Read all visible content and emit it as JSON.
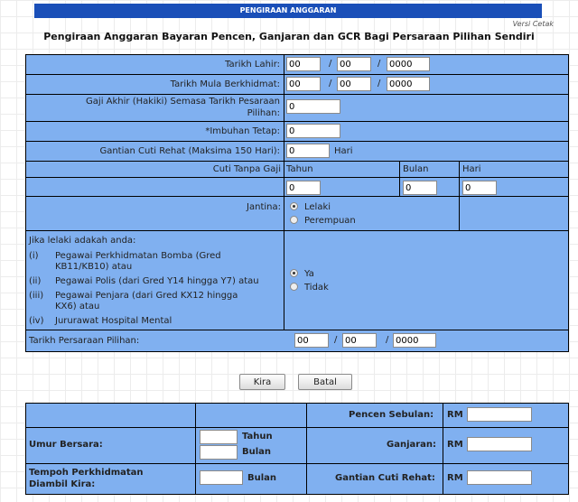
{
  "header": {
    "bar_title": "PENGIRAAN ANGGARAN",
    "print_link": "Versi Cetak",
    "page_title": "Pengiraan Anggaran Bayaran Pencen, Ganjaran dan GCR Bagi Persaraan Pilihan Sendiri"
  },
  "form": {
    "dob": {
      "label": "Tarikh Lahir:",
      "day": "00",
      "month": "00",
      "year": "0000"
    },
    "start_date": {
      "label": "Tarikh Mula Berkhidmat:",
      "day": "00",
      "month": "00",
      "year": "0000"
    },
    "last_salary": {
      "label_line1": "Gaji Akhir (Hakiki) Semasa Tarikh Pesaraan",
      "label_line2": "Pilihan:",
      "value": "0"
    },
    "allowance": {
      "label": "*Imbuhan Tetap:",
      "value": "0"
    },
    "leave_replacement": {
      "label": "Gantian Cuti Rehat (Maksima 150 Hari):",
      "value": "0",
      "unit": "Hari"
    },
    "unpaid_leave": {
      "label": "Cuti Tanpa Gaji",
      "col_years": "Tahun",
      "col_months": "Bulan",
      "col_days": "Hari",
      "years": "0",
      "months": "0",
      "days": "0"
    },
    "gender": {
      "label": "Jantina:",
      "options": [
        "Lelaki",
        "Perempuan"
      ],
      "selected": "Lelaki"
    },
    "special_service": {
      "question": "Jika lelaki adakah anda:",
      "items": [
        {
          "num": "(i)",
          "line1": "Pegawai Perkhidmatan Bomba (Gred",
          "line2": "KB11/KB10) atau"
        },
        {
          "num": "(ii)",
          "line1": "Pegawai Polis (dari Gred Y14 hingga Y7) atau",
          "line2": ""
        },
        {
          "num": "(iii)",
          "line1": "Pegawai Penjara (dari Gred KX12 hingga",
          "line2": "KX6) atau"
        },
        {
          "num": "(iv)",
          "line1": "Jururawat Hospital Mental",
          "line2": ""
        }
      ],
      "options": [
        "Ya",
        "Tidak"
      ],
      "selected": "Ya"
    },
    "retirement_date": {
      "label": "Tarikh Persaraan Pilihan:",
      "day": "00",
      "month": "00",
      "year": "0000"
    },
    "sep": "/"
  },
  "actions": {
    "calculate": "Kira",
    "cancel": "Batal"
  },
  "results": {
    "monthly_pension": "Pencen Sebulan:",
    "age": "Umur Bersara:",
    "age_years_unit": "Tahun",
    "age_months_unit": "Bulan",
    "gratuity": "Ganjaran:",
    "service_label_line1": "Tempoh Perkhidmatan",
    "service_label_line2": "Diambil Kira:",
    "service_unit": "Bulan",
    "leave_cash": "Gantian Cuti Rehat:",
    "currency": "RM"
  },
  "colors": {
    "bar": "#1a4fb8",
    "cell": "#80b0f0",
    "border": "#000000"
  }
}
